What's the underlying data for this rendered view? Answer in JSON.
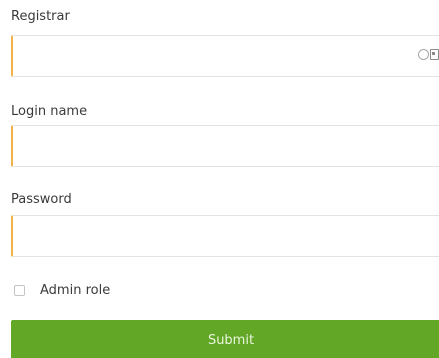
{
  "form": {
    "registrar": {
      "label": "Registrar",
      "value": "",
      "placeholder": ""
    },
    "login_name": {
      "label": "Login name",
      "value": "",
      "placeholder": ""
    },
    "password": {
      "label": "Password",
      "value": "",
      "placeholder": ""
    },
    "admin_role": {
      "label": "Admin role",
      "checked": false
    },
    "submit_label": "Submit"
  },
  "autofill_icons": [
    "circle-icon",
    "card-icon"
  ],
  "colors": {
    "focus_accent": "#f2b34a",
    "submit_background": "#62a826",
    "input_border": "#e3e3e3"
  }
}
